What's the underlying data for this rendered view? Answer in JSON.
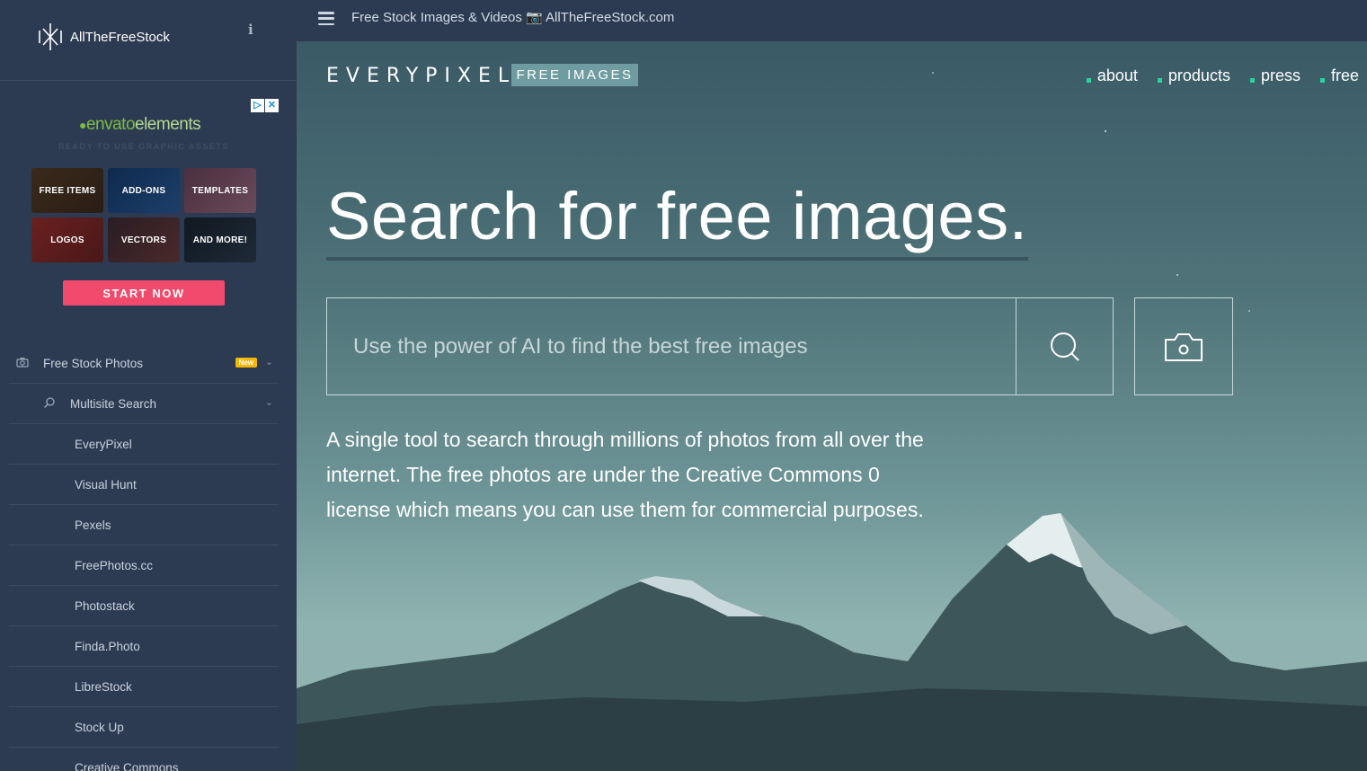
{
  "sidebar": {
    "brand": "AllTheFreeStock",
    "ad": {
      "logo_part1": "envato",
      "logo_part2": "elements",
      "tagline": "READY TO USE GRAPHIC ASSETS",
      "tiles": [
        "FREE ITEMS",
        "ADD-ONS",
        "TEMPLATES",
        "LOGOS",
        "VECTORS",
        "AND MORE!"
      ],
      "cta": "START NOW"
    },
    "nav": [
      {
        "label": "Free Stock Photos",
        "badge": "New"
      },
      {
        "label": "Multisite Search"
      },
      {
        "label": "EveryPixel"
      },
      {
        "label": "Visual Hunt"
      },
      {
        "label": "Pexels"
      },
      {
        "label": "FreePhotos.cc"
      },
      {
        "label": "Photostack"
      },
      {
        "label": "Finda.Photo"
      },
      {
        "label": "LibreStock"
      },
      {
        "label": "Stock Up"
      },
      {
        "label": "Creative Commons"
      }
    ]
  },
  "topbar": {
    "title": "Free Stock Images & Videos 📷 AllTheFreeStock.com"
  },
  "hero": {
    "logo": "EVERYPIXEL",
    "badge": "FREE IMAGES",
    "nav": [
      "about",
      "products",
      "press",
      "free"
    ],
    "headline": "Search for free images.",
    "search_placeholder": "Use the power of AI to find the best free images",
    "description": "A single tool to search through millions of photos from all over the internet. The free photos are under the Creative Commons 0 license which means you can use them for commercial purposes."
  },
  "colors": {
    "sidebar_bg": "#2d3b52",
    "accent_cta": "#f14a6c",
    "nav_dot": "#2ad4a0",
    "badge_new": "#f5b800"
  }
}
